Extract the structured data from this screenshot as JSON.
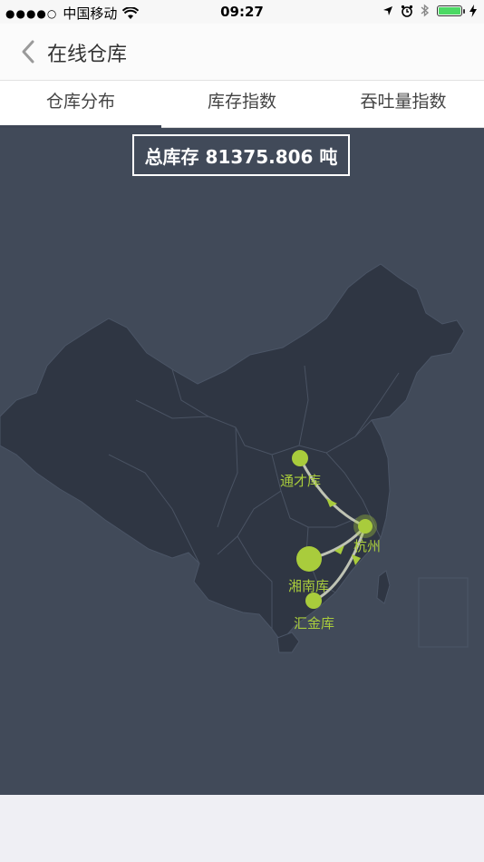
{
  "status": {
    "carrier": "中国移动",
    "time": "09:27"
  },
  "nav": {
    "title": "在线仓库"
  },
  "tabs": [
    {
      "label": "仓库分布",
      "active": true
    },
    {
      "label": "库存指数",
      "active": false
    },
    {
      "label": "吞吐量指数",
      "active": false
    }
  ],
  "map": {
    "total_label": "总库存 81375.806 吨",
    "accent_color": "#a9cc3c",
    "land_color": "#2f3643",
    "background_color": "#414a59",
    "origin": {
      "name": "杭州"
    },
    "warehouses": [
      {
        "name": "通才库"
      },
      {
        "name": "湘南库"
      },
      {
        "name": "汇金库"
      }
    ]
  }
}
